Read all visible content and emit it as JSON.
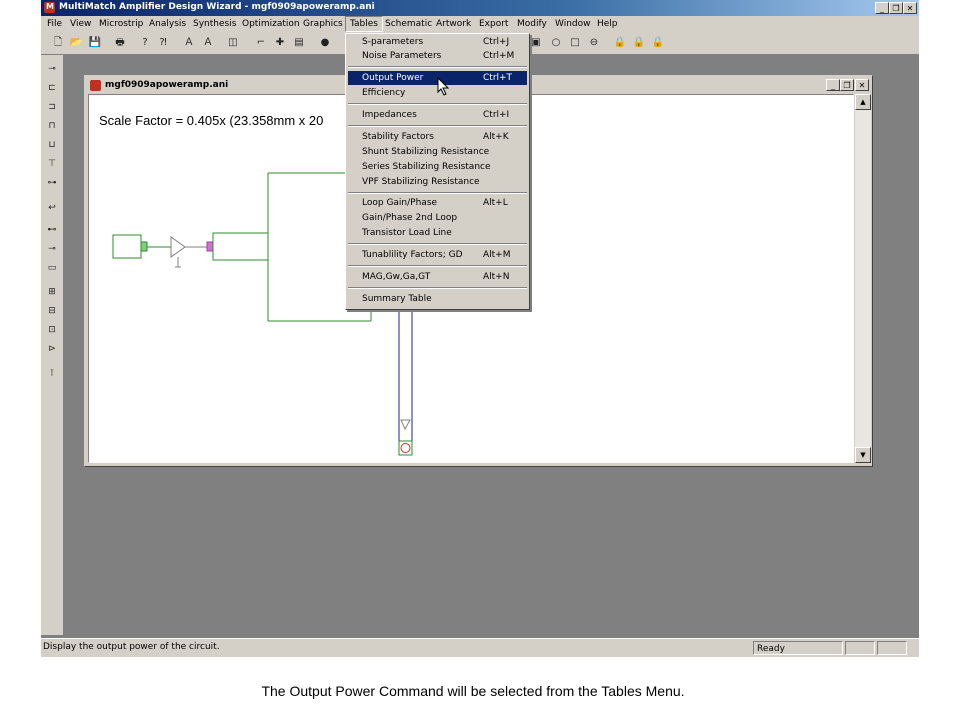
{
  "window": {
    "title": "MultiMatch Amplifier Design Wizard - mgf0909apoweramp.ani"
  },
  "caption_buttons": {
    "minimize": "_",
    "restore": "❐",
    "close": "✕"
  },
  "menubar": [
    {
      "label": "File"
    },
    {
      "label": "View"
    },
    {
      "label": "Microstrip"
    },
    {
      "label": "Analysis"
    },
    {
      "label": "Synthesis"
    },
    {
      "label": "Optimization"
    },
    {
      "label": "Graphics"
    },
    {
      "label": "Tables"
    },
    {
      "label": "Schematic"
    },
    {
      "label": "Artwork"
    },
    {
      "label": "Export"
    },
    {
      "label": "Modify"
    },
    {
      "label": "Window"
    },
    {
      "label": "Help"
    }
  ],
  "child_window": {
    "title": "mgf0909apoweramp.ani",
    "scale_text": "Scale Factor =  0.405x (23.358mm x 20"
  },
  "tables_menu": {
    "items": [
      {
        "label": "S-parameters",
        "shortcut": "Ctrl+J"
      },
      {
        "label": "Noise Parameters",
        "shortcut": "Ctrl+M"
      },
      {
        "label": "Output Power",
        "shortcut": "Ctrl+T",
        "selected": true
      },
      {
        "label": "Efficiency",
        "shortcut": ""
      },
      {
        "label": "Impedances",
        "shortcut": "Ctrl+I"
      },
      {
        "label": "Stability Factors",
        "shortcut": "Alt+K"
      },
      {
        "label": "Shunt Stabilizing Resistance",
        "shortcut": ""
      },
      {
        "label": "Series Stabilizing Resistance",
        "shortcut": ""
      },
      {
        "label": "VPF Stabilizing Resistance",
        "shortcut": ""
      },
      {
        "label": "Loop Gain/Phase",
        "shortcut": "Alt+L"
      },
      {
        "label": "Gain/Phase 2nd Loop",
        "shortcut": ""
      },
      {
        "label": "Transistor Load Line",
        "shortcut": ""
      },
      {
        "label": "Tunablility Factors; GD",
        "shortcut": "Alt+M"
      },
      {
        "label": "MAG,Gw,Ga,GT",
        "shortcut": "Alt+N"
      },
      {
        "label": "Summary Table",
        "shortcut": ""
      }
    ]
  },
  "statusbar": {
    "message": "Display the output power of the circuit.",
    "state": "Ready"
  },
  "caption": "The Output Power Command will be selected from the Tables Menu.",
  "colors": {
    "title_active": "#0a246a",
    "menu_face": "#d4d0c8",
    "circuit_green": "#2e8b2e",
    "circuit_blue": "#2020a0"
  }
}
